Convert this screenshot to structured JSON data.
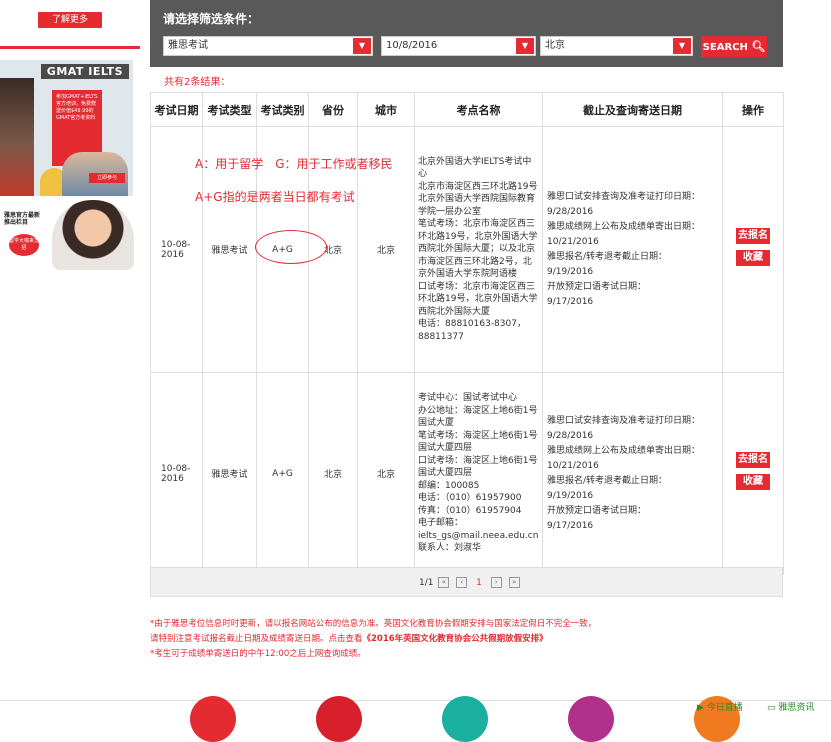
{
  "sidebar": {
    "learn_more": "了解更多",
    "gmat_logo": "GMAT IELTS",
    "promo_text": "参加GMAT+IELTS官方培训，免费赠送价值$49.99的GMAT官方考资料",
    "join_label": "立即参与",
    "ad2_text": "雅思官方最新推出栏目",
    "ad2_badge": "留学大咖来支招"
  },
  "filter": {
    "title": "请选择筛选条件：",
    "exam_value": "雅思考试",
    "date_value": "10/8/2016",
    "city_value": "北京",
    "search_label": "SEARCH"
  },
  "result_count": "共有2条结果：",
  "table": {
    "headers": [
      "考试日期",
      "考试类型",
      "考试类别",
      "省份",
      "城市",
      "考点名称",
      "截止及查询寄送日期",
      "操作"
    ],
    "rows": [
      {
        "date": "10-08-2016",
        "type": "雅思考试",
        "category": "A+G",
        "province": "北京",
        "city": "北京",
        "venue": "北京外国语大学IELTS考试中心\n北京市海淀区西三环北路19号北京外国语大学西院国际教育学院一层办公室\n笔试考场：北京市海淀区西三环北路19号，北京外国语大学西院北外国际大厦；以及北京市海淀区西三环北路2号，北京外国语大学东院阿语楼\n口试考场：北京市海淀区西三环北路19号，北京外国语大学西院北外国际大厦\n电话：88810163-8307，88811377",
        "deadlines": "雅思口试安排查询及准考证打印日期：\n9/28/2016\n雅思成绩网上公布及成绩单寄出日期：\n10/21/2016\n雅思报名/转考退考截止日期：\n9/19/2016\n开放预定口语考试日期：\n9/17/2016",
        "register": "去报名",
        "favorite": "收藏"
      },
      {
        "date": "10-08-2016",
        "type": "雅思考试",
        "category": "A+G",
        "province": "北京",
        "city": "北京",
        "venue": "考试中心：国试考试中心\n办公地址：海淀区上地6街1号 国试大厦\n笔试考场：海淀区上地6街1号 国试大厦四层\n口试考场：海淀区上地6街1号 国试大厦四层\n邮编：100085\n电话：（010）61957900\n传真：（010）61957904\n电子邮箱：\nielts_gs@mail.neea.edu.cn\n联系人：刘淑华",
        "deadlines": "雅思口试安排查询及准考证打印日期：\n9/28/2016\n雅思成绩网上公布及成绩单寄出日期：\n10/21/2016\n雅思报名/转考退考截止日期：\n9/19/2016\n开放预定口语考试日期：\n9/17/2016",
        "register": "去报名",
        "favorite": "收藏"
      }
    ]
  },
  "pager": {
    "summary": "1/1",
    "current": "1"
  },
  "annotations": {
    "line1": "A：用于留学　G：用于工作或者移民",
    "line2": "A+G指的是两者当日都有考试"
  },
  "notes": {
    "line1": "*由于雅思考位信息时时更新，请以报名网站公布的信息为准。英国文化教育协会假期安排与国家法定假日不完全一致，",
    "line2a": "请特别注意考试报名截止日期及成绩寄送日期。点击查看",
    "line2b": "《2016年英国文化教育协会公共假期放假安排》",
    "line3": "*考生可于成绩单寄送日的中午12:00之后上网查询成绩。"
  },
  "footer": {
    "live": "今日直播",
    "news": "雅思资讯"
  },
  "colors": {
    "accent": "#e32b31",
    "filter_bg": "#595959"
  }
}
